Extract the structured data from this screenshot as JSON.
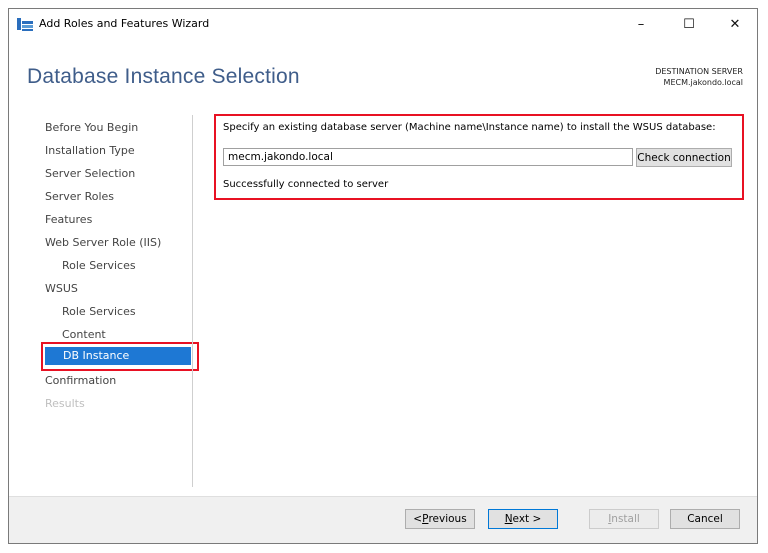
{
  "window": {
    "title": "Add Roles and Features Wizard",
    "controls": {
      "minimize": "–",
      "maximize": "☐",
      "close": "✕"
    }
  },
  "header": {
    "title": "Database Instance Selection",
    "destination_label": "DESTINATION SERVER",
    "destination_server": "MECM.jakondo.local"
  },
  "nav": {
    "items": [
      {
        "label": "Before You Begin"
      },
      {
        "label": "Installation Type"
      },
      {
        "label": "Server Selection"
      },
      {
        "label": "Server Roles"
      },
      {
        "label": "Features"
      },
      {
        "label": "Web Server Role (IIS)"
      },
      {
        "label": "Role Services"
      },
      {
        "label": "WSUS"
      },
      {
        "label": "Role Services"
      },
      {
        "label": "Content"
      },
      {
        "label": "DB Instance"
      },
      {
        "label": "Confirmation"
      },
      {
        "label": "Results"
      }
    ]
  },
  "main": {
    "instruction": "Specify an existing database server (Machine name\\Instance name) to install the WSUS database:",
    "db_value": "mecm.jakondo.local",
    "check_button": "Check connection",
    "status": "Successfully connected to server"
  },
  "footer": {
    "previous_prefix": "< ",
    "previous_accel": "P",
    "previous_rest": "revious",
    "next_accel": "N",
    "next_rest": "ext >",
    "install_accel": "I",
    "install_rest": "nstall",
    "cancel": "Cancel"
  },
  "colors": {
    "accent": "#1e78d4",
    "highlight_border": "#e81123",
    "title": "#3f5d8a"
  }
}
